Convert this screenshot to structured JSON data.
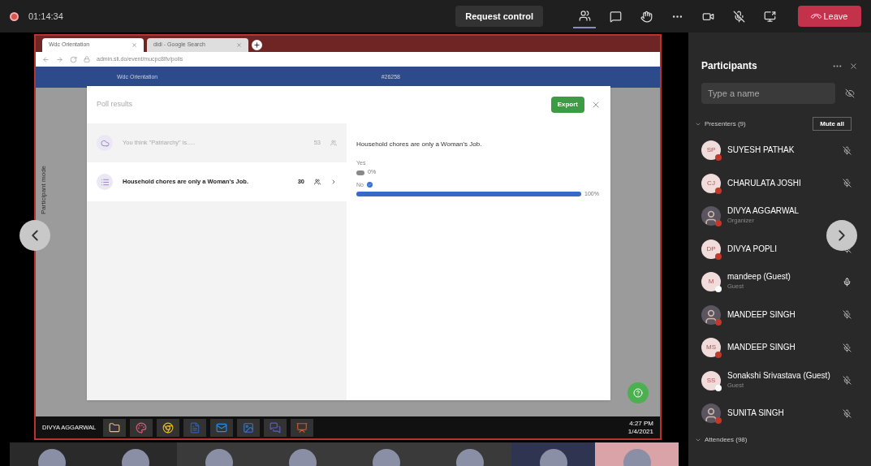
{
  "top_bar": {
    "recording": true,
    "timer": "01:14:34",
    "request_control": "Request control",
    "tools": [
      {
        "kind": "people",
        "selected": true
      },
      {
        "kind": "chat",
        "selected": false
      },
      {
        "kind": "hand",
        "selected": false
      },
      {
        "kind": "more",
        "selected": false
      },
      {
        "kind": "camera",
        "selected": false
      },
      {
        "kind": "mic-off",
        "selected": false
      },
      {
        "kind": "share",
        "selected": false
      }
    ],
    "leave": "Leave"
  },
  "shared_screen": {
    "browser_tabs": [
      {
        "title": "Wdc Orientation",
        "selected": true
      },
      {
        "title": "didi - Google Search",
        "selected": false
      }
    ],
    "address": "admin.sli.do/event/mucpc8lfv/polls",
    "site_title": "Wdc Orientation",
    "event_code": "#26258",
    "side_label": "Participant mode",
    "modal": {
      "title": "Poll results",
      "export": "Export",
      "polls": [
        {
          "kind": "cloud",
          "question": "You think \"Patriarchy\" is.....",
          "count": "53",
          "selected": false
        },
        {
          "kind": "list",
          "question": "Household chores are only a Woman's Job.",
          "count": "30",
          "selected": true
        }
      ],
      "result": {
        "question": "Household chores are only a Woman's Job.",
        "options": [
          {
            "label": "Yes",
            "percent": "0%",
            "level": 0,
            "checked": false
          },
          {
            "label": "No",
            "percent": "100%",
            "level": 1,
            "checked": true
          }
        ]
      }
    },
    "taskbar": {
      "presenter": "DIVYA AGGARWAL",
      "apps": [
        {
          "kind": "folder"
        },
        {
          "kind": "paint"
        },
        {
          "kind": "chrome"
        },
        {
          "kind": "word"
        },
        {
          "kind": "outlook"
        },
        {
          "kind": "photos"
        },
        {
          "kind": "teams"
        },
        {
          "kind": "powerpoint"
        }
      ],
      "time": "4:27 PM",
      "date": "1/4/2021"
    }
  },
  "participants": {
    "title": "Participants",
    "search": {
      "placeholder": "Type a name"
    },
    "presenters_header": "Presenters (9)",
    "mute_all": "Mute all",
    "people": [
      {
        "name": "SUYESH PATHAK",
        "initials": "SP",
        "kind": "initials",
        "color": "#c0392b",
        "muted": true
      },
      {
        "name": "CHARULATA JOSHI",
        "initials": "CJ",
        "kind": "initials",
        "color": "#c0392b",
        "muted": true
      },
      {
        "name": "DIVYA AGGARWAL",
        "role": "Organizer",
        "kind": "photo",
        "color": "#c0392b"
      },
      {
        "name": "DIVYA POPLI",
        "initials": "DP",
        "kind": "initials",
        "color": "#c0392b",
        "muted": true
      },
      {
        "name": "mandeep (Guest)",
        "role": "Guest",
        "initials": "M",
        "kind": "initials",
        "color": "#ffffff",
        "muted": false
      },
      {
        "name": "MANDEEP SINGH",
        "kind": "photo",
        "color": "#c0392b",
        "muted": true
      },
      {
        "name": "MANDEEP SINGH",
        "initials": "MS",
        "kind": "initials",
        "color": "#c0392b",
        "muted": true
      },
      {
        "name": "Sonakshi Srivastava (Guest)",
        "role": "Guest",
        "initials": "SS",
        "kind": "initials",
        "color": "#ffffff",
        "muted": true
      },
      {
        "name": "SUNITA SINGH",
        "kind": "photo",
        "color": "#c0392b",
        "muted": true
      }
    ],
    "attendees_header": "Attendees (98)"
  },
  "video_strip": {
    "tiles": [
      {
        "kind": "dark"
      },
      {
        "kind": "dark"
      },
      {
        "kind": "gray"
      },
      {
        "kind": "gray"
      },
      {
        "kind": "gray"
      },
      {
        "kind": "gray"
      },
      {
        "kind": "blue"
      },
      {
        "kind": "pink"
      }
    ]
  }
}
